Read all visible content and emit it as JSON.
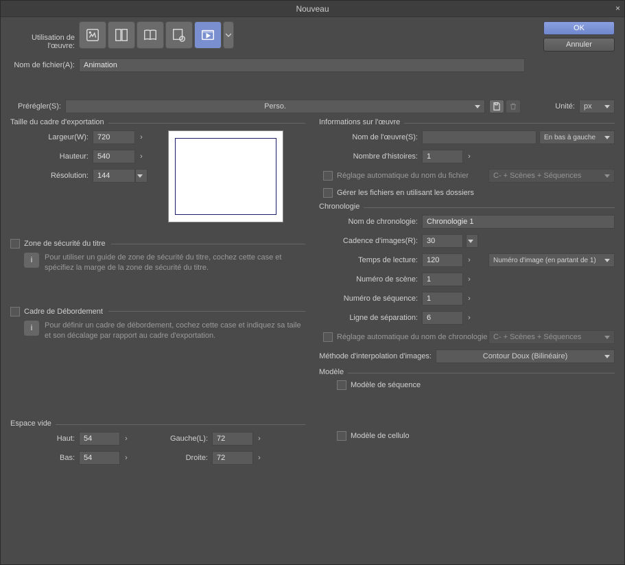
{
  "title": "Nouveau",
  "buttons": {
    "ok": "OK",
    "cancel": "Annuler"
  },
  "usage_label": "Utilisation de l'œuvre:",
  "filename_label": "Nom de fichier(A):",
  "filename_value": "Animation",
  "preset_label": "Prérégler(S):",
  "preset_value": "Perso.",
  "unit_label": "Unité:",
  "unit_value": "px",
  "export": {
    "group": "Taille du cadre d'exportation",
    "width_label": "Largeur(W):",
    "width": "720",
    "height_label": "Hauteur:",
    "height": "540",
    "res_label": "Résolution:",
    "res": "144"
  },
  "safezone": {
    "check_label": "Zone de sécurité du titre",
    "help": "Pour utiliser un guide de zone de sécurité du titre, cochez cette case et spécifiez la marge de la zone de sécurité du titre."
  },
  "overflow": {
    "check_label": "Cadre de Débordement",
    "help": "Pour définir un cadre de débordement, cochez cette case et indiquez sa taile et son décalage par rapport au cadre d'exportation."
  },
  "blank": {
    "group": "Espace vide",
    "top_label": "Haut:",
    "top": "54",
    "bottom_label": "Bas:",
    "bottom": "54",
    "left_label": "Gauche(L):",
    "left": "72",
    "right_label": "Droite:",
    "right": "72"
  },
  "work": {
    "group": "Informations sur l'œuvre",
    "name_label": "Nom de l'œuvre(S):",
    "name": "",
    "position": "En bas à gauche",
    "stories_label": "Nombre d'histoires:",
    "stories": "1",
    "autoname_label": "Réglage automatique du nom du fichier",
    "autoname_pattern": "C- + Scènes + Séquences",
    "folders_label": "Gérer les fichiers en utilisant les dossiers"
  },
  "chrono": {
    "group": "Chronologie",
    "tl_name_label": "Nom de chronologie:",
    "tl_name": "Chronologie 1",
    "fps_label": "Cadence d'images(R):",
    "fps": "30",
    "play_label": "Temps de lecture:",
    "play": "120",
    "play_mode": "Numéro d'image (en partant de 1)",
    "scene_label": "Numéro de scène:",
    "scene": "1",
    "seq_label": "Numéro de séquence:",
    "seq": "1",
    "sep_label": "Ligne de séparation:",
    "sep": "6",
    "auto_tl_label": "Réglage automatique du nom de chronologie",
    "auto_tl_pattern": "C- + Scènes + Séquences",
    "interp_label": "Méthode d'interpolation d'images:",
    "interp": "Contour Doux (Bilinéaire)"
  },
  "tpl": {
    "group": "Modèle",
    "seq": "Modèle de séquence",
    "cel": "Modèle de cellulo"
  }
}
